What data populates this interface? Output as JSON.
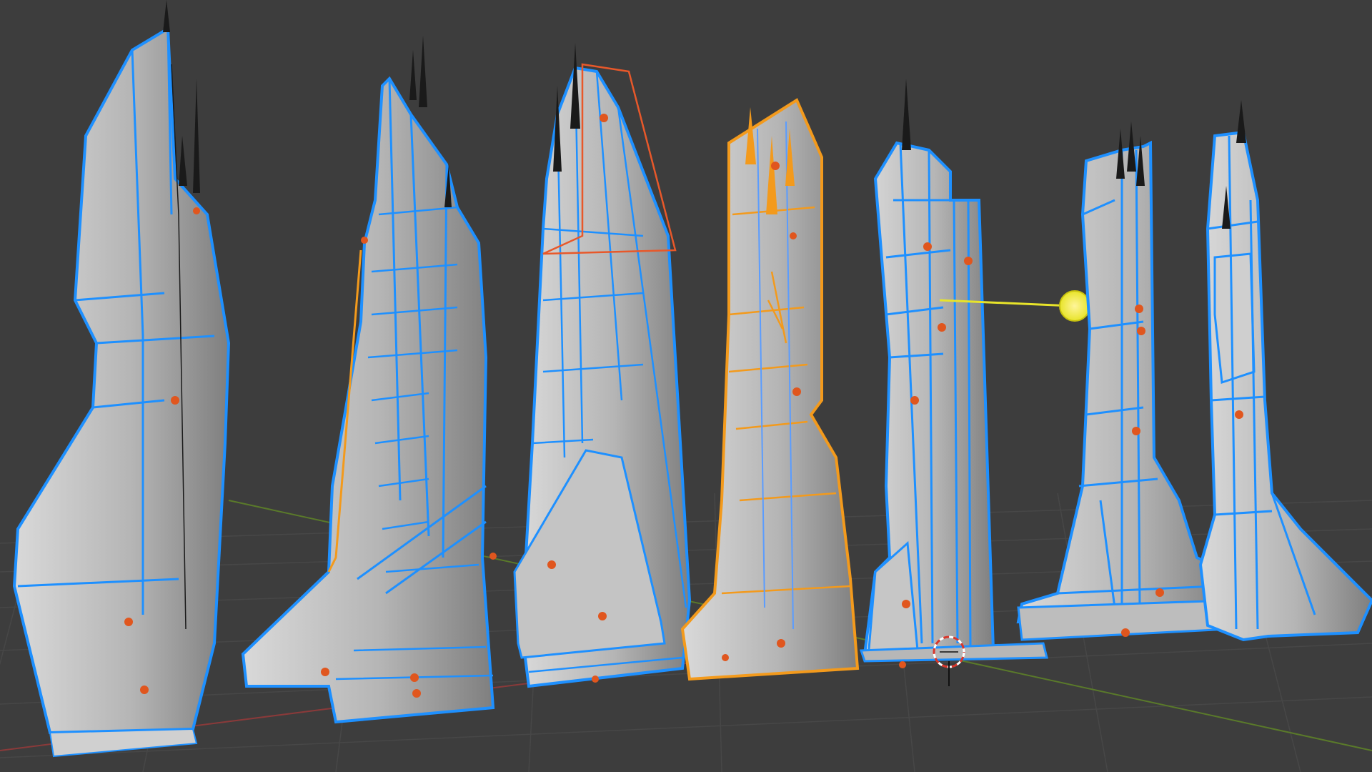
{
  "viewport": {
    "name": "3d-viewport",
    "colors": {
      "background": "#3d3d3d",
      "grid": "#474747",
      "x_axis": "#8a3a3a",
      "y_axis": "#5a7a2a",
      "mesh_face": "#b9b9b9",
      "mesh_face_dark": "#8e8e8e",
      "selected_wire": "#1e90ff",
      "active_wire": "#f39a1c",
      "origin_dot": "#e0561e",
      "light": "#e8e42a",
      "camera_wire": "#e8582a",
      "antenna": "#1a1a1a"
    },
    "objects": [
      {
        "name": "tower-01",
        "state": "selected"
      },
      {
        "name": "tower-02",
        "state": "selected"
      },
      {
        "name": "tower-03",
        "state": "selected"
      },
      {
        "name": "tower-04",
        "state": "active"
      },
      {
        "name": "tower-05",
        "state": "selected"
      },
      {
        "name": "tower-06",
        "state": "selected"
      },
      {
        "name": "tower-07",
        "state": "selected"
      }
    ],
    "scene_items": [
      "point-light",
      "camera",
      "3d-cursor"
    ]
  }
}
